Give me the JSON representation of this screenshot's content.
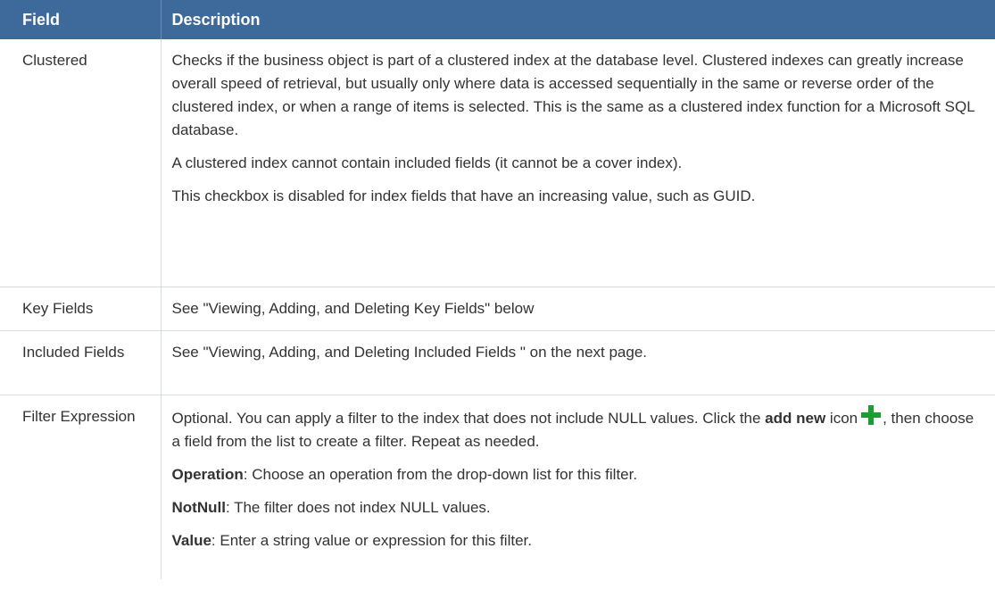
{
  "header": {
    "field": "Field",
    "description": "Description"
  },
  "rows": [
    {
      "field": "Clustered",
      "paragraphs": [
        "Checks if the business object is part of a clustered index at the database level. Clustered indexes can greatly increase overall speed of retrieval, but usually only where data is accessed sequentially in the same or reverse order of the clustered index, or when a range of items is selected. This is the same as a clustered index function for a Microsoft SQL database.",
        "A clustered index cannot contain included fields (it cannot be a cover index).",
        "This checkbox is disabled for index fields that have an increasing value, such as GUID."
      ]
    },
    {
      "field": "Key Fields",
      "paragraphs": [
        "See \"Viewing, Adding, and Deleting Key Fields\" below"
      ]
    },
    {
      "field": "Included Fields",
      "paragraphs": [
        "See \"Viewing, Adding, and Deleting Included Fields \" on the next page."
      ]
    },
    {
      "field": "Filter Expression",
      "intro": {
        "before": "Optional. You can apply a filter to the index that does not include NULL values. Click the ",
        "bold": "add new",
        "middle": " icon",
        "icon": "add-new-plus-icon",
        "after": ", then choose a field from the list to create a filter. Repeat as needed."
      },
      "items": [
        {
          "term": "Operation",
          "text": ": Choose an operation from the drop-down list for this filter."
        },
        {
          "term": "NotNull",
          "text": ": The filter does not index NULL values."
        },
        {
          "term": "Value",
          "text": ": Enter a string value or expression for this filter."
        }
      ]
    }
  ],
  "colors": {
    "header_bg": "#3d6a9a",
    "header_text": "#ffffff",
    "body_text": "#333333",
    "border": "#d6dbe1",
    "add_icon": "#1a9e2e"
  }
}
